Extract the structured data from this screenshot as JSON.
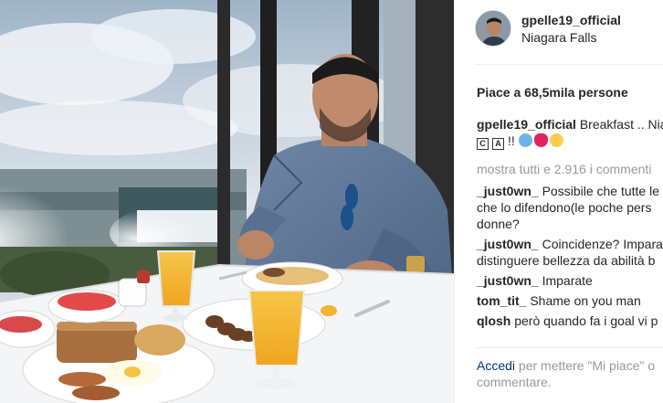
{
  "post": {
    "username": "gpelle19_official",
    "location": "Niagara Falls",
    "likes_text": "Piace a 68,5mila persone",
    "caption": {
      "user": "gpelle19_official",
      "text": "Breakfast .. Niagara Falls",
      "box1": "C",
      "box2": "A",
      "marks": "!!"
    },
    "view_all": "mostra tutti e 2.916 i commenti",
    "comments": [
      {
        "user": "_just0wn_",
        "text": "Possibile che tutte le",
        "cont1": "che lo difendono(le poche pers",
        "cont2": "donne?"
      },
      {
        "user": "_just0wn_",
        "text": "Coincidenze? Impara",
        "cont1": "distinguere bellezza da abilità b"
      },
      {
        "user": "_just0wn_",
        "text": "Imparate"
      },
      {
        "user": "tom_tit_",
        "text": "Shame on you man"
      },
      {
        "user": "qlosh",
        "text": "però quando fa i goal vi p"
      }
    ],
    "login_link": "Accedi",
    "login_text": "per mettere \"Mi piace\" o",
    "login_text2": "commentare."
  },
  "icons": {
    "emoji_1": "fearful-face-icon",
    "emoji_2": "red-heart-icon",
    "emoji_3": "heart-eyes-face-icon"
  },
  "colors": {
    "link": "#003569",
    "muted": "#999999",
    "text": "#262626"
  }
}
